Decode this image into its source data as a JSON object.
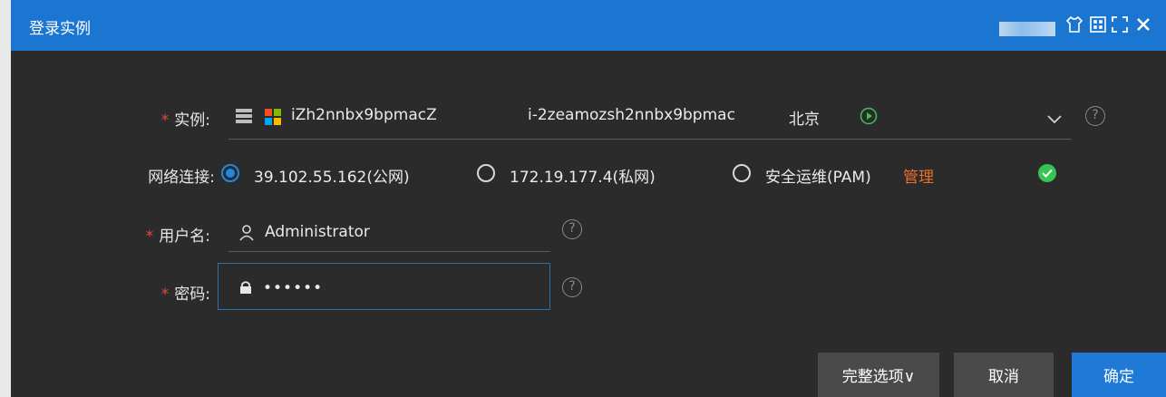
{
  "dialog": {
    "title": "登录实例"
  },
  "window_controls": [
    {
      "name": "skin-icon"
    },
    {
      "name": "grid-icon"
    },
    {
      "name": "fullscreen-icon"
    },
    {
      "name": "close-icon"
    }
  ],
  "instance": {
    "required_mark": "*",
    "label": "实例:",
    "name": "iZh2nnbx9bpmacZ",
    "id": "i-2zeamozsh2nnbx9bpmac",
    "region": "北京",
    "help": "?"
  },
  "network": {
    "label": "网络连接:",
    "options": [
      {
        "label": "39.102.55.162(公网)",
        "selected": true
      },
      {
        "label": "172.19.177.4(私网)",
        "selected": false
      },
      {
        "label": "安全运维(PAM)",
        "selected": false
      }
    ],
    "manage_link": "管理"
  },
  "username": {
    "required_mark": "*",
    "label": "用户名:",
    "value": "Administrator",
    "help": "?"
  },
  "password": {
    "required_mark": "*",
    "label": "密码:",
    "value": "••••••",
    "help": "?"
  },
  "buttons": {
    "more_options": "完整选项∨",
    "cancel": "取消",
    "confirm": "确定"
  },
  "colors": {
    "titlebar": "#1b76d1",
    "body": "#2b2b2b",
    "primary_button": "#1e7ad6",
    "secondary_button": "#4a4a4a",
    "required": "#e04a3f",
    "link": "#e8702a",
    "success": "#35c552"
  }
}
